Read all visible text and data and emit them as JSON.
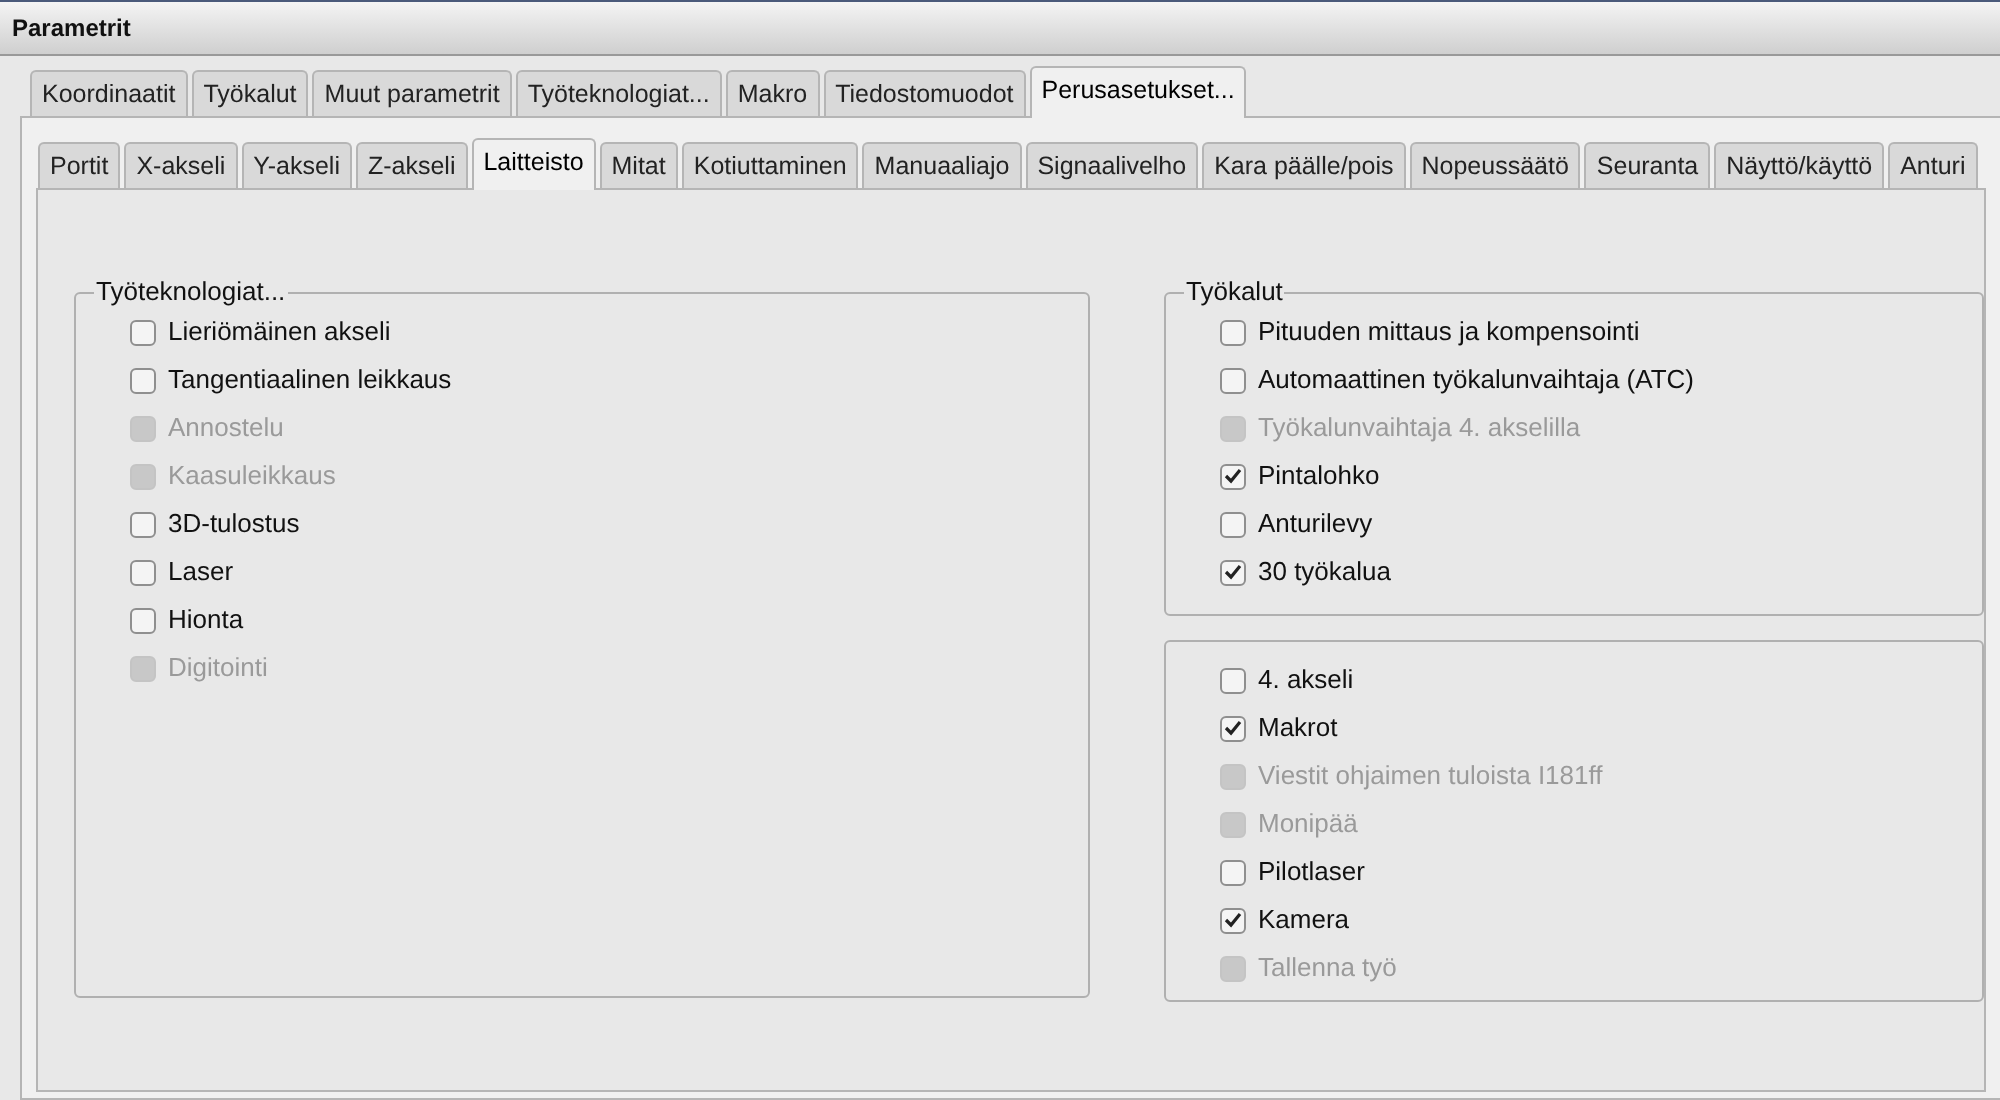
{
  "window": {
    "title": "Parametrit"
  },
  "tabs": [
    {
      "label": "Koordinaatit",
      "selected": false
    },
    {
      "label": "Työkalut",
      "selected": false
    },
    {
      "label": "Muut parametrit",
      "selected": false
    },
    {
      "label": "Työteknologiat...",
      "selected": false
    },
    {
      "label": "Makro",
      "selected": false
    },
    {
      "label": "Tiedostomuodot",
      "selected": false
    },
    {
      "label": "Perusasetukset...",
      "selected": true
    }
  ],
  "subtabs": [
    {
      "label": "Portit",
      "selected": false
    },
    {
      "label": "X-akseli",
      "selected": false
    },
    {
      "label": "Y-akseli",
      "selected": false
    },
    {
      "label": "Z-akseli",
      "selected": false
    },
    {
      "label": "Laitteisto",
      "selected": true
    },
    {
      "label": "Mitat",
      "selected": false
    },
    {
      "label": "Kotiuttaminen",
      "selected": false
    },
    {
      "label": "Manuaaliajo",
      "selected": false
    },
    {
      "label": "Signaalivelho",
      "selected": false
    },
    {
      "label": "Kara päälle/pois",
      "selected": false
    },
    {
      "label": "Nopeussäätö",
      "selected": false
    },
    {
      "label": "Seuranta",
      "selected": false
    },
    {
      "label": "Näyttö/käyttö",
      "selected": false
    },
    {
      "label": "Anturi",
      "selected": false
    }
  ],
  "groups": [
    {
      "title": "Työteknologiat...",
      "items": [
        {
          "label": "Lieriömäinen akseli",
          "checked": false,
          "disabled": false
        },
        {
          "label": "Tangentiaalinen leikkaus",
          "checked": false,
          "disabled": false
        },
        {
          "label": "Annostelu",
          "checked": false,
          "disabled": true
        },
        {
          "label": "Kaasuleikkaus",
          "checked": false,
          "disabled": true
        },
        {
          "label": "3D-tulostus",
          "checked": false,
          "disabled": false
        },
        {
          "label": "Laser",
          "checked": false,
          "disabled": false
        },
        {
          "label": "Hionta",
          "checked": false,
          "disabled": false
        },
        {
          "label": "Digitointi",
          "checked": false,
          "disabled": true
        }
      ]
    },
    {
      "title": "Työkalut",
      "items": [
        {
          "label": "Pituuden mittaus ja kompensointi",
          "checked": false,
          "disabled": false
        },
        {
          "label": "Automaattinen työkalunvaihtaja (ATC)",
          "checked": false,
          "disabled": false
        },
        {
          "label": "Työkalunvaihtaja 4. akselilla",
          "checked": false,
          "disabled": true
        },
        {
          "label": "Pintalohko",
          "checked": true,
          "disabled": false
        },
        {
          "label": "Anturilevy",
          "checked": false,
          "disabled": false
        },
        {
          "label": "30 työkalua",
          "checked": true,
          "disabled": false
        }
      ]
    },
    {
      "items": [
        {
          "label": "4. akseli",
          "checked": false,
          "disabled": false
        },
        {
          "label": "Makrot",
          "checked": true,
          "disabled": false
        },
        {
          "label": "Viestit ohjaimen tuloista I181ff",
          "checked": false,
          "disabled": true
        },
        {
          "label": "Monipää",
          "checked": false,
          "disabled": true
        },
        {
          "label": "Pilotlaser",
          "checked": false,
          "disabled": false
        },
        {
          "label": "Kamera",
          "checked": true,
          "disabled": false
        },
        {
          "label": "Tallenna työ",
          "checked": false,
          "disabled": true
        }
      ]
    }
  ]
}
